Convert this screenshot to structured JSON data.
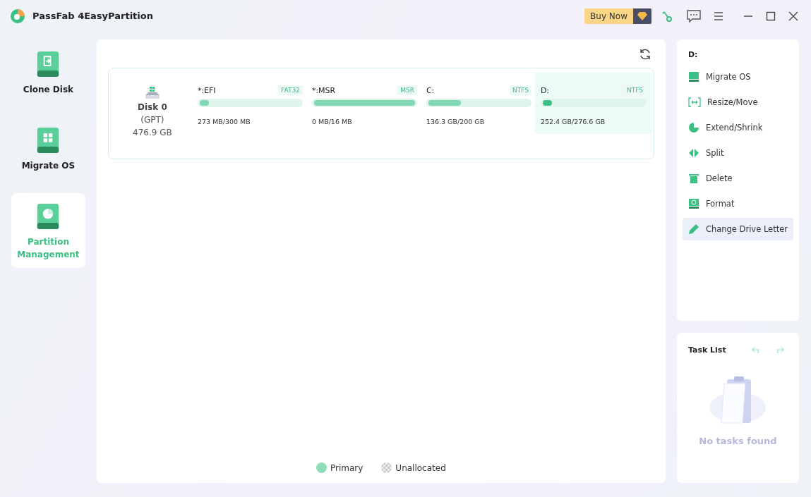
{
  "window": {
    "title": "PassFab 4EasyPartition",
    "buy_button": "Buy Now"
  },
  "sidebar": {
    "items": [
      {
        "label": "Clone Disk",
        "kind": "clone",
        "selected": false
      },
      {
        "label": "Migrate OS",
        "kind": "migrate",
        "selected": false
      },
      {
        "label": "Partition Management",
        "kind": "partition",
        "selected": true
      }
    ]
  },
  "disk": {
    "name": "Disk 0",
    "scheme": "(GPT)",
    "size": "476.9 GB",
    "partitions": [
      {
        "name": "*:EFI",
        "fs": "FAT32",
        "usage": "273 MB/300 MB",
        "level": 0.09,
        "selected": false
      },
      {
        "name": "*:MSR",
        "fs": "MSR",
        "usage": "0 MB/16 MB",
        "level": 1.0,
        "selected": false
      },
      {
        "name": "C:",
        "fs": "NTFS",
        "usage": "136.3 GB/200 GB",
        "level": 0.32,
        "selected": false
      },
      {
        "name": "D:",
        "fs": "NTFS",
        "usage": "252.4 GB/276.6 GB",
        "level": 0.09,
        "selected": true
      }
    ]
  },
  "legend": [
    {
      "label": "Primary",
      "kind": "primary"
    },
    {
      "label": "Unallocated",
      "kind": "unallocated"
    }
  ],
  "actions": {
    "title": "D:",
    "items": [
      {
        "label": "Migrate OS",
        "kind": "migrate",
        "selected": false
      },
      {
        "label": "Resize/Move",
        "kind": "resize",
        "selected": false
      },
      {
        "label": "Extend/Shrink",
        "kind": "extend",
        "selected": false
      },
      {
        "label": "Split",
        "kind": "split",
        "selected": false
      },
      {
        "label": "Delete",
        "kind": "delete",
        "selected": false
      },
      {
        "label": "Format",
        "kind": "format",
        "selected": false
      },
      {
        "label": "Change Drive Letter",
        "kind": "letter",
        "selected": true
      }
    ]
  },
  "task_list": {
    "title": "Task List",
    "empty_text": "No tasks found"
  }
}
